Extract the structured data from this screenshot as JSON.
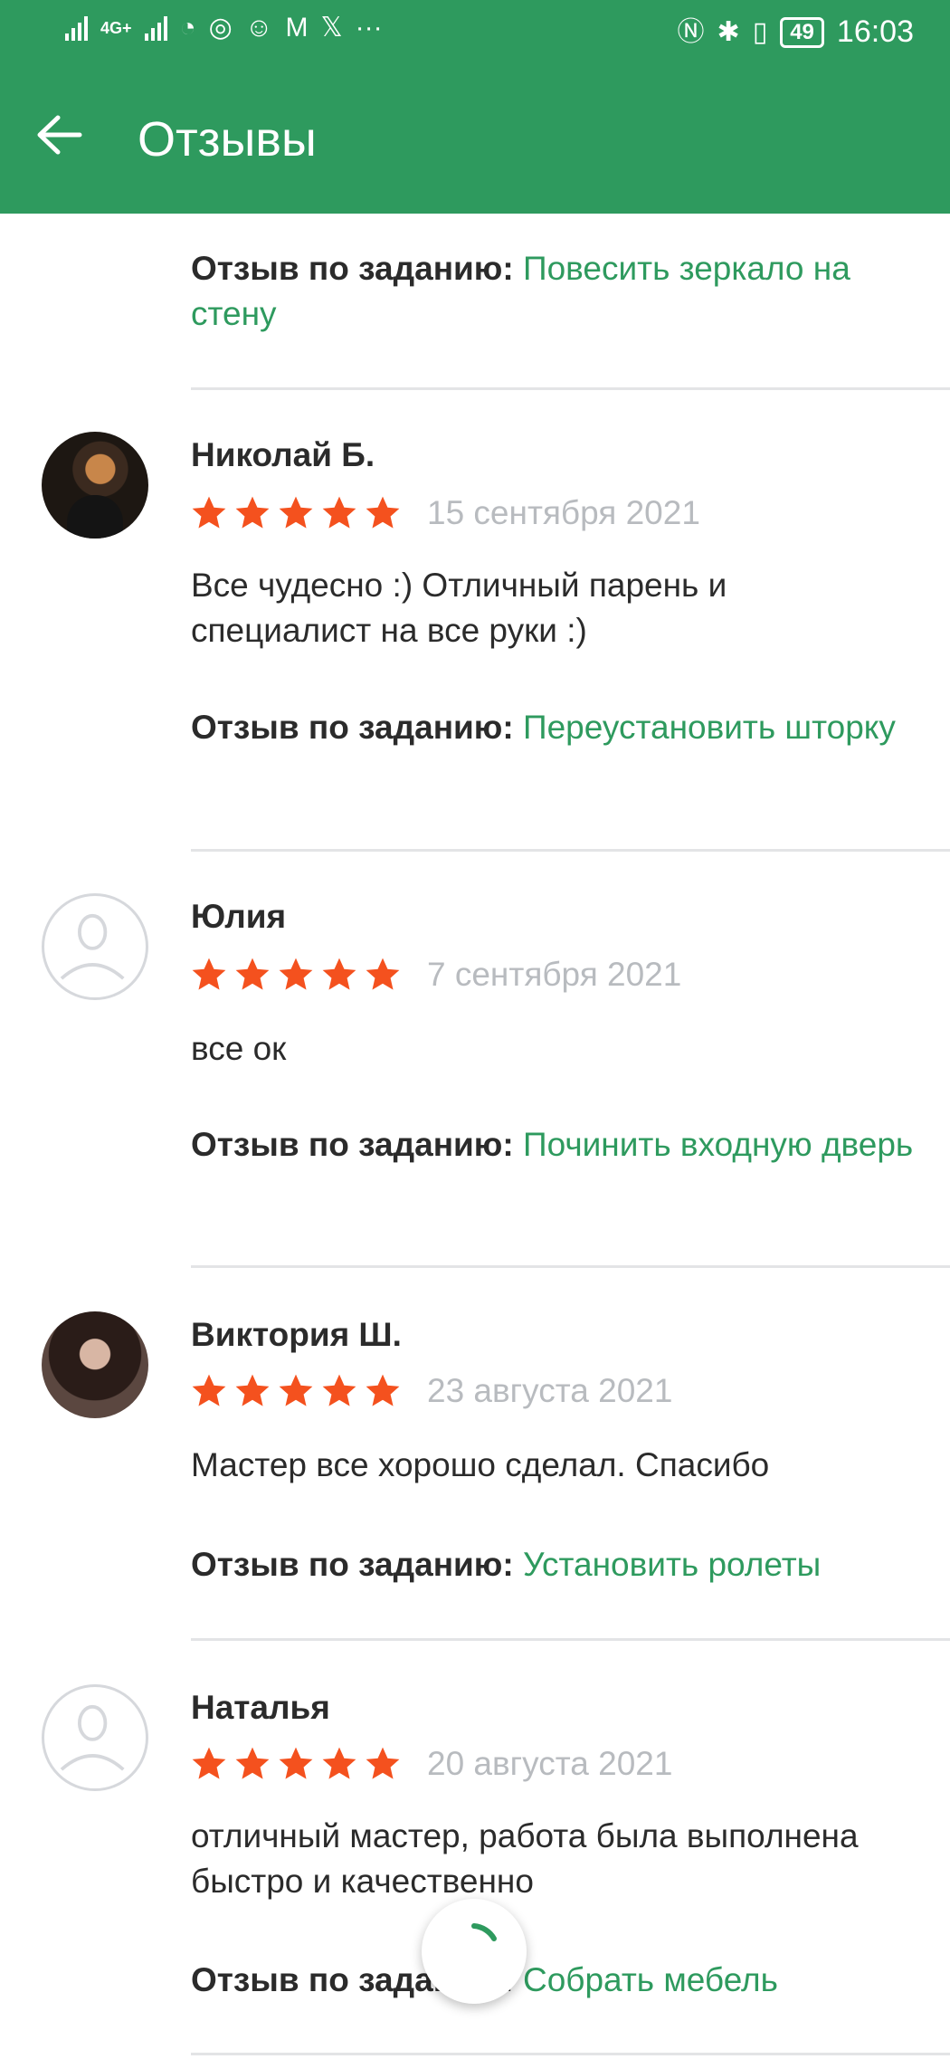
{
  "status_bar": {
    "network_label": "4G+",
    "battery": "49",
    "time": "16:03"
  },
  "header": {
    "title": "Отзывы",
    "back_icon": "arrow-left-icon"
  },
  "task_label": "Отзыв по заданию:",
  "first_task": {
    "label": "Отзыв по заданию:",
    "link": "Повесить зеркало на стену"
  },
  "reviews": [
    {
      "name": "Николай Б.",
      "rating": 5,
      "date": "15 сентября 2021",
      "text": "Все чудесно :) Отличный парень и специалист на все руки :)",
      "task_label": "Отзыв по заданию:",
      "task_link": "Переустановить шторку"
    },
    {
      "name": "Юлия",
      "rating": 5,
      "date": "7 сентября 2021",
      "text": "все ок",
      "task_label": "Отзыв по заданию:",
      "task_link": "Починить входную дверь"
    },
    {
      "name": "Виктория Ш.",
      "rating": 5,
      "date": "23 августа 2021",
      "text": "Мастер все хорошо сделал. Спасибо",
      "task_label": "Отзыв по заданию:",
      "task_link": "Установить ролеты"
    },
    {
      "name": "Наталья",
      "rating": 5,
      "date": "20 августа 2021",
      "text": "отличный мастер, работа была выполнена быстро и качественно",
      "task_label": "Отзыв по заданию:",
      "task_link": "Собрать мебель"
    }
  ],
  "colors": {
    "brand_green": "#2e9a5e",
    "star_orange": "#f4511e",
    "date_gray": "#b8bbbf"
  }
}
